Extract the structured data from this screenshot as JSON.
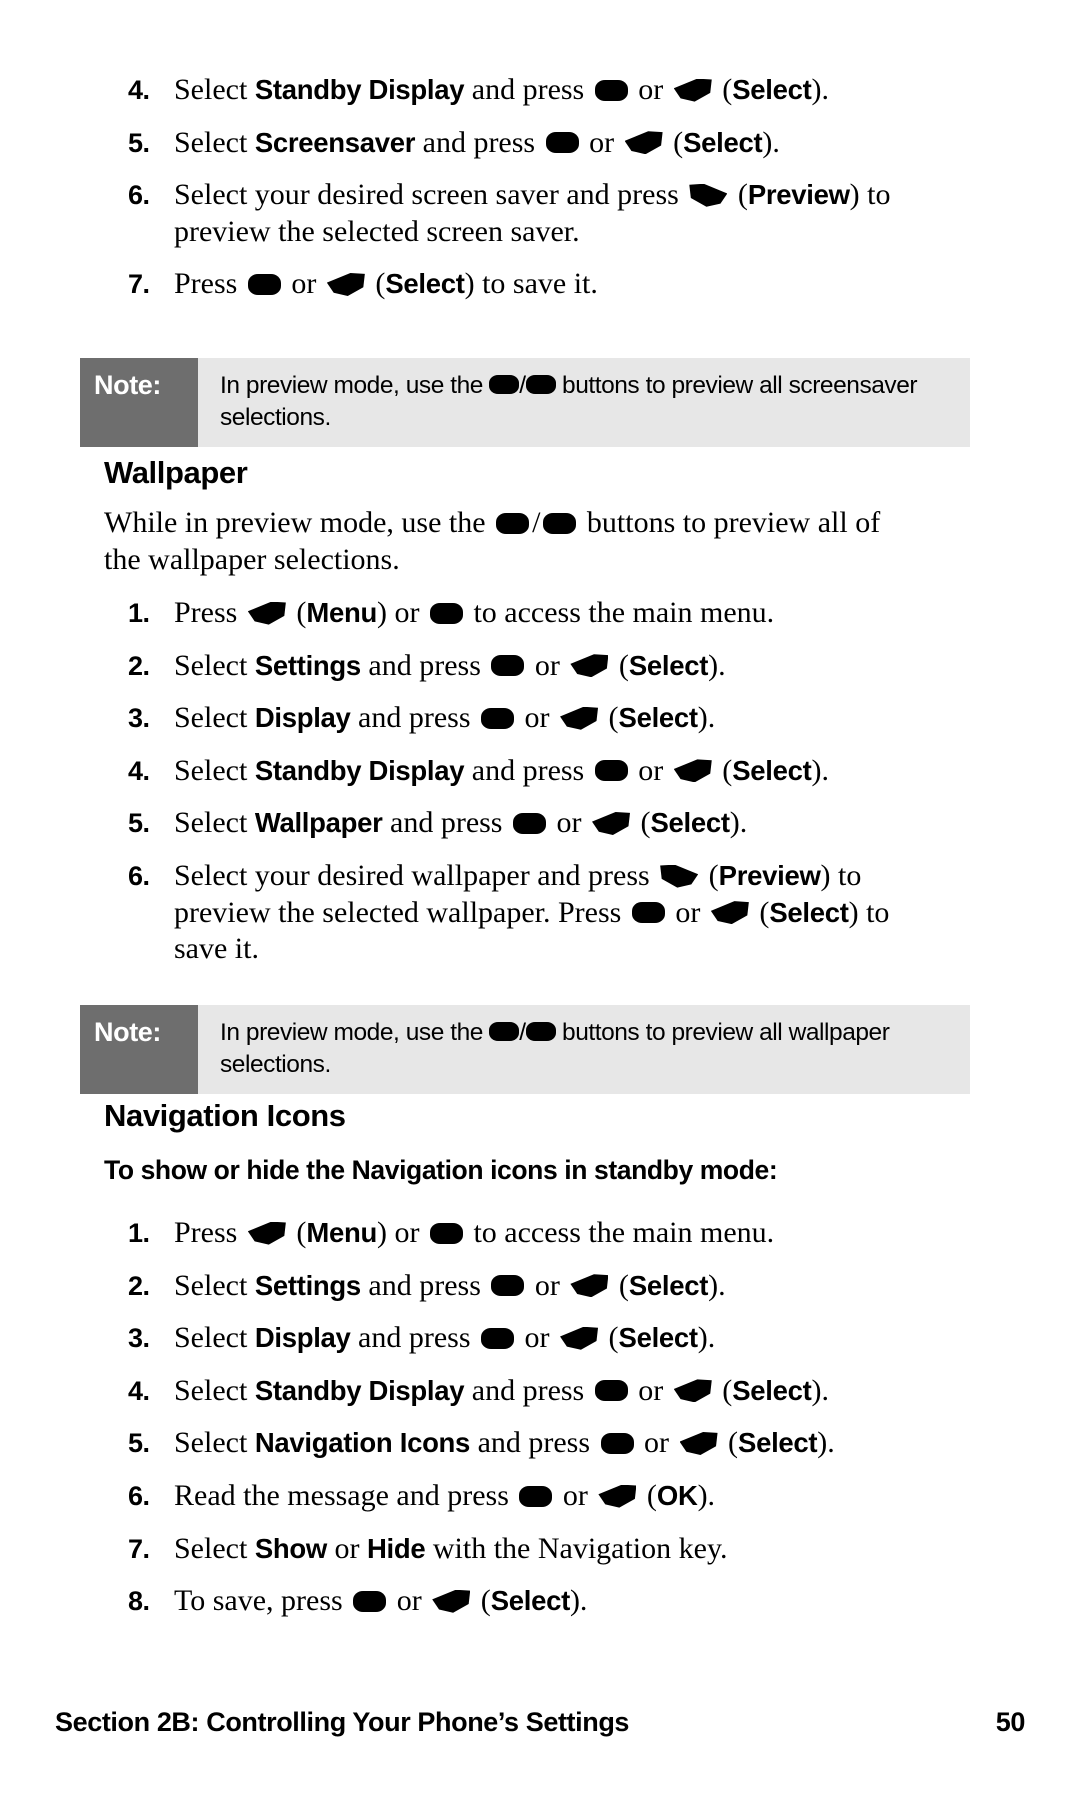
{
  "footer": {
    "section": "Section 2B: Controlling Your Phone’s Settings",
    "page_number": "50"
  },
  "icons": {
    "ok_key": "ok-key-icon",
    "left_softkey": "left-softkey-icon",
    "right_softkey": "right-softkey-icon"
  },
  "screensaver_steps": {
    "items": [
      {
        "num": "4.",
        "parts": [
          {
            "t": "text",
            "v": "Select "
          },
          {
            "t": "bold",
            "v": "Standby Display"
          },
          {
            "t": "text",
            "v": " and press "
          },
          {
            "t": "icon",
            "v": "ok"
          },
          {
            "t": "text",
            "v": " or "
          },
          {
            "t": "icon",
            "v": "softkey-left"
          },
          {
            "t": "text",
            "v": " ("
          },
          {
            "t": "bold",
            "v": "Select"
          },
          {
            "t": "text",
            "v": ")."
          }
        ]
      },
      {
        "num": "5.",
        "parts": [
          {
            "t": "text",
            "v": "Select "
          },
          {
            "t": "bold",
            "v": "Screensaver"
          },
          {
            "t": "text",
            "v": " and press "
          },
          {
            "t": "icon",
            "v": "ok"
          },
          {
            "t": "text",
            "v": " or "
          },
          {
            "t": "icon",
            "v": "softkey-left"
          },
          {
            "t": "text",
            "v": " ("
          },
          {
            "t": "bold",
            "v": "Select"
          },
          {
            "t": "text",
            "v": ")."
          }
        ]
      },
      {
        "num": "6.",
        "parts": [
          {
            "t": "text",
            "v": "Select your desired screen saver and press "
          },
          {
            "t": "icon",
            "v": "softkey-right"
          },
          {
            "t": "text",
            "v": " ("
          },
          {
            "t": "bold",
            "v": "Preview"
          },
          {
            "t": "text",
            "v": ") to preview the selected screen saver."
          }
        ]
      },
      {
        "num": "7.",
        "parts": [
          {
            "t": "text",
            "v": "Press "
          },
          {
            "t": "icon",
            "v": "ok"
          },
          {
            "t": "text",
            "v": " or "
          },
          {
            "t": "icon",
            "v": "softkey-left"
          },
          {
            "t": "text",
            "v": " ("
          },
          {
            "t": "bold",
            "v": "Select"
          },
          {
            "t": "text",
            "v": ") to save it."
          }
        ]
      }
    ]
  },
  "note_screensaver": {
    "label": "Note:",
    "parts": [
      {
        "t": "text",
        "v": "In preview mode, use the "
      },
      {
        "t": "icon",
        "v": "ok-note"
      },
      {
        "t": "text",
        "v": "/"
      },
      {
        "t": "icon",
        "v": "ok-note"
      },
      {
        "t": "text",
        "v": " buttons to preview all screensaver selections."
      }
    ]
  },
  "wallpaper": {
    "heading": "Wallpaper",
    "intro_parts": [
      {
        "t": "text",
        "v": "While in preview mode, use the "
      },
      {
        "t": "icon",
        "v": "ok"
      },
      {
        "t": "text",
        "v": "/"
      },
      {
        "t": "icon",
        "v": "ok"
      },
      {
        "t": "text",
        "v": " buttons to preview all of the wallpaper selections."
      }
    ],
    "steps": [
      {
        "num": "1.",
        "parts": [
          {
            "t": "text",
            "v": "Press "
          },
          {
            "t": "icon",
            "v": "softkey-left"
          },
          {
            "t": "text",
            "v": " ("
          },
          {
            "t": "bold",
            "v": "Menu"
          },
          {
            "t": "text",
            "v": ") or "
          },
          {
            "t": "icon",
            "v": "ok"
          },
          {
            "t": "text",
            "v": " to access the main menu."
          }
        ]
      },
      {
        "num": "2.",
        "parts": [
          {
            "t": "text",
            "v": "Select "
          },
          {
            "t": "bold",
            "v": "Settings"
          },
          {
            "t": "text",
            "v": " and press "
          },
          {
            "t": "icon",
            "v": "ok"
          },
          {
            "t": "text",
            "v": " or "
          },
          {
            "t": "icon",
            "v": "softkey-left"
          },
          {
            "t": "text",
            "v": " ("
          },
          {
            "t": "bold",
            "v": "Select"
          },
          {
            "t": "text",
            "v": ")."
          }
        ]
      },
      {
        "num": "3.",
        "parts": [
          {
            "t": "text",
            "v": "Select "
          },
          {
            "t": "bold",
            "v": "Display"
          },
          {
            "t": "text",
            "v": " and press "
          },
          {
            "t": "icon",
            "v": "ok"
          },
          {
            "t": "text",
            "v": " or "
          },
          {
            "t": "icon",
            "v": "softkey-left"
          },
          {
            "t": "text",
            "v": " ("
          },
          {
            "t": "bold",
            "v": "Select"
          },
          {
            "t": "text",
            "v": ")."
          }
        ]
      },
      {
        "num": "4.",
        "parts": [
          {
            "t": "text",
            "v": "Select "
          },
          {
            "t": "bold",
            "v": "Standby Display"
          },
          {
            "t": "text",
            "v": " and press "
          },
          {
            "t": "icon",
            "v": "ok"
          },
          {
            "t": "text",
            "v": " or "
          },
          {
            "t": "icon",
            "v": "softkey-left"
          },
          {
            "t": "text",
            "v": " ("
          },
          {
            "t": "bold",
            "v": "Select"
          },
          {
            "t": "text",
            "v": ")."
          }
        ]
      },
      {
        "num": "5.",
        "parts": [
          {
            "t": "text",
            "v": "Select "
          },
          {
            "t": "bold",
            "v": "Wallpaper"
          },
          {
            "t": "text",
            "v": " and press "
          },
          {
            "t": "icon",
            "v": "ok"
          },
          {
            "t": "text",
            "v": " or "
          },
          {
            "t": "icon",
            "v": "softkey-left"
          },
          {
            "t": "text",
            "v": " ("
          },
          {
            "t": "bold",
            "v": "Select"
          },
          {
            "t": "text",
            "v": ")."
          }
        ]
      },
      {
        "num": "6.",
        "parts": [
          {
            "t": "text",
            "v": "Select your desired wallpaper and press "
          },
          {
            "t": "icon",
            "v": "softkey-right"
          },
          {
            "t": "text",
            "v": " ("
          },
          {
            "t": "bold",
            "v": "Preview"
          },
          {
            "t": "text",
            "v": ") to preview the selected wallpaper. Press "
          },
          {
            "t": "icon",
            "v": "ok"
          },
          {
            "t": "text",
            "v": " or "
          },
          {
            "t": "icon",
            "v": "softkey-left"
          },
          {
            "t": "text",
            "v": " ("
          },
          {
            "t": "bold",
            "v": "Select"
          },
          {
            "t": "text",
            "v": ") to save it."
          }
        ]
      }
    ]
  },
  "note_wallpaper": {
    "label": "Note:",
    "parts": [
      {
        "t": "text",
        "v": "In preview mode, use the "
      },
      {
        "t": "icon",
        "v": "ok-note"
      },
      {
        "t": "text",
        "v": "/"
      },
      {
        "t": "icon",
        "v": "ok-note"
      },
      {
        "t": "text",
        "v": " buttons to preview all wallpaper selections."
      }
    ]
  },
  "navigation_icons": {
    "heading": "Navigation Icons",
    "subhead": "To show or hide the Navigation icons in standby mode:",
    "steps": [
      {
        "num": "1.",
        "parts": [
          {
            "t": "text",
            "v": "Press "
          },
          {
            "t": "icon",
            "v": "softkey-left"
          },
          {
            "t": "text",
            "v": " ("
          },
          {
            "t": "bold",
            "v": "Menu"
          },
          {
            "t": "text",
            "v": ") or "
          },
          {
            "t": "icon",
            "v": "ok"
          },
          {
            "t": "text",
            "v": " to access the main menu."
          }
        ]
      },
      {
        "num": "2.",
        "parts": [
          {
            "t": "text",
            "v": "Select "
          },
          {
            "t": "bold",
            "v": "Settings"
          },
          {
            "t": "text",
            "v": " and press "
          },
          {
            "t": "icon",
            "v": "ok"
          },
          {
            "t": "text",
            "v": " or "
          },
          {
            "t": "icon",
            "v": "softkey-left"
          },
          {
            "t": "text",
            "v": " ("
          },
          {
            "t": "bold",
            "v": "Select"
          },
          {
            "t": "text",
            "v": ")."
          }
        ]
      },
      {
        "num": "3.",
        "parts": [
          {
            "t": "text",
            "v": "Select "
          },
          {
            "t": "bold",
            "v": "Display"
          },
          {
            "t": "text",
            "v": " and press "
          },
          {
            "t": "icon",
            "v": "ok"
          },
          {
            "t": "text",
            "v": " or "
          },
          {
            "t": "icon",
            "v": "softkey-left"
          },
          {
            "t": "text",
            "v": " ("
          },
          {
            "t": "bold",
            "v": "Select"
          },
          {
            "t": "text",
            "v": ")."
          }
        ]
      },
      {
        "num": "4.",
        "parts": [
          {
            "t": "text",
            "v": "Select "
          },
          {
            "t": "bold",
            "v": "Standby Display"
          },
          {
            "t": "text",
            "v": " and press "
          },
          {
            "t": "icon",
            "v": "ok"
          },
          {
            "t": "text",
            "v": " or "
          },
          {
            "t": "icon",
            "v": "softkey-left"
          },
          {
            "t": "text",
            "v": " ("
          },
          {
            "t": "bold",
            "v": "Select"
          },
          {
            "t": "text",
            "v": ")."
          }
        ]
      },
      {
        "num": "5.",
        "parts": [
          {
            "t": "text",
            "v": "Select "
          },
          {
            "t": "bold",
            "v": "Navigation Icons"
          },
          {
            "t": "text",
            "v": " and press "
          },
          {
            "t": "icon",
            "v": "ok"
          },
          {
            "t": "text",
            "v": " or "
          },
          {
            "t": "icon",
            "v": "softkey-left"
          },
          {
            "t": "text",
            "v": " ("
          },
          {
            "t": "bold",
            "v": "Select"
          },
          {
            "t": "text",
            "v": ")."
          }
        ]
      },
      {
        "num": "6.",
        "parts": [
          {
            "t": "text",
            "v": "Read the message and press "
          },
          {
            "t": "icon",
            "v": "ok"
          },
          {
            "t": "text",
            "v": " or "
          },
          {
            "t": "icon",
            "v": "softkey-left"
          },
          {
            "t": "text",
            "v": " ("
          },
          {
            "t": "bold",
            "v": "OK"
          },
          {
            "t": "text",
            "v": ")."
          }
        ]
      },
      {
        "num": "7.",
        "parts": [
          {
            "t": "text",
            "v": "Select "
          },
          {
            "t": "bold",
            "v": "Show"
          },
          {
            "t": "text",
            "v": " or "
          },
          {
            "t": "bold",
            "v": "Hide"
          },
          {
            "t": "text",
            "v": " with the Navigation key."
          }
        ]
      },
      {
        "num": "8.",
        "parts": [
          {
            "t": "text",
            "v": "To save, press "
          },
          {
            "t": "icon",
            "v": "ok"
          },
          {
            "t": "text",
            "v": " or "
          },
          {
            "t": "icon",
            "v": "softkey-left"
          },
          {
            "t": "text",
            "v": " ("
          },
          {
            "t": "bold",
            "v": "Select"
          },
          {
            "t": "text",
            "v": ")."
          }
        ]
      }
    ]
  }
}
